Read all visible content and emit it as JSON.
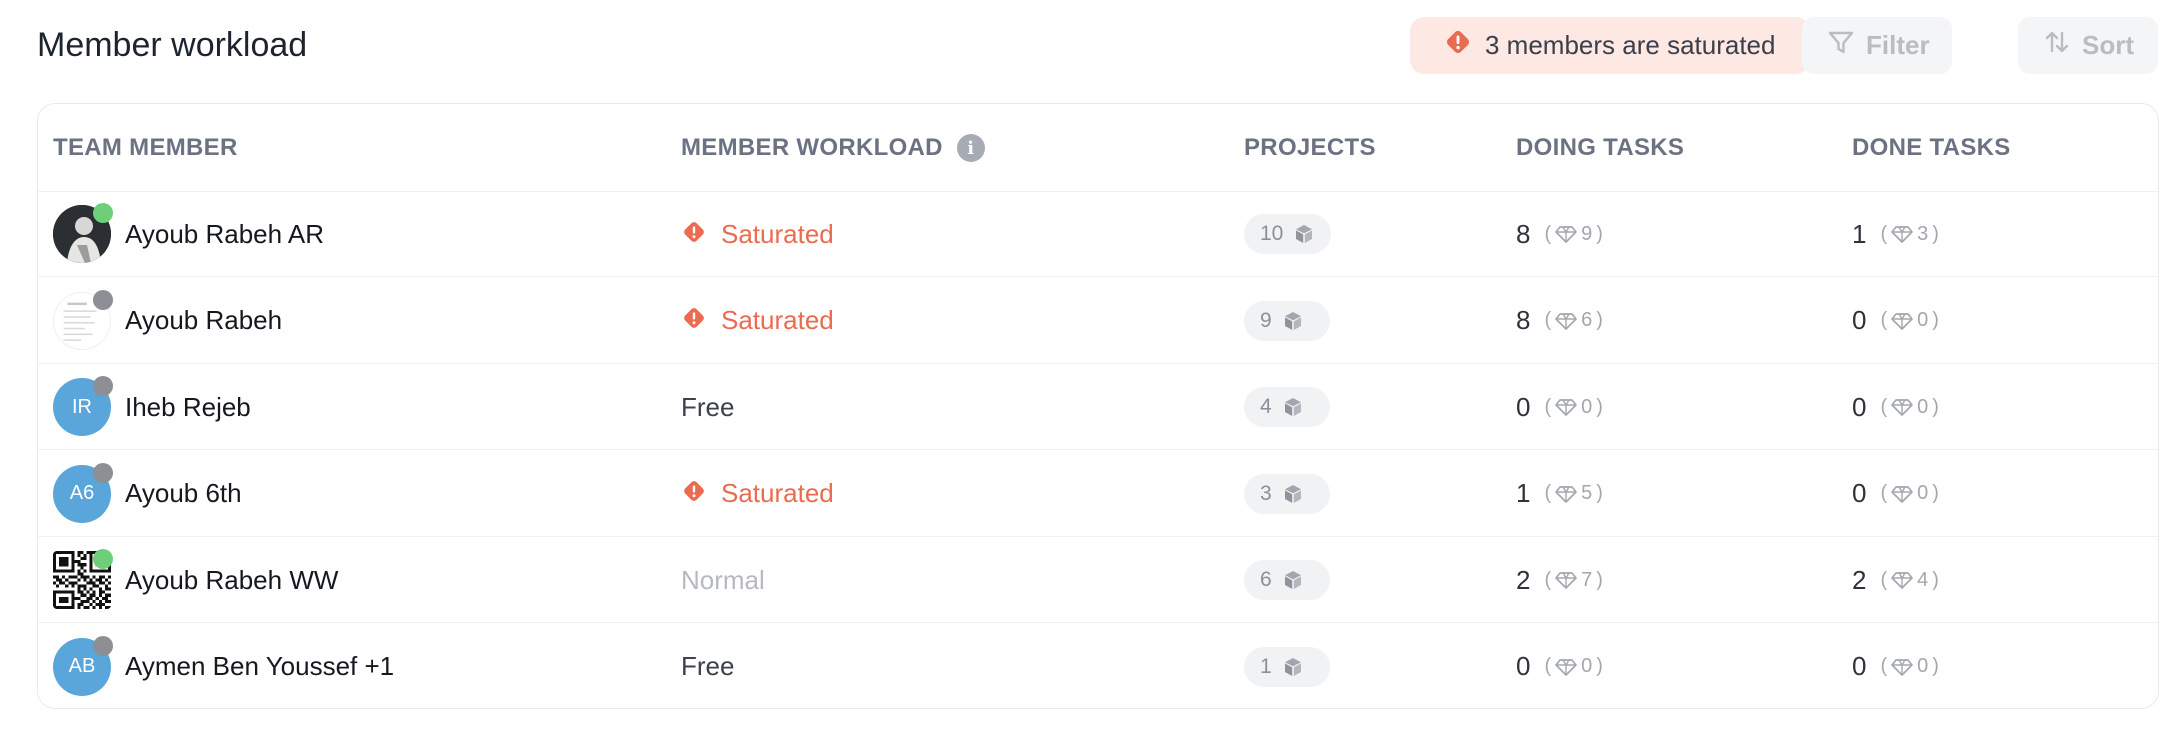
{
  "header": {
    "title": "Member workload",
    "alert_text": "3 members are saturated",
    "filter_label": "Filter",
    "sort_label": "Sort"
  },
  "colors": {
    "saturated": "#ea6b4f",
    "online": "#6fcf78",
    "offline": "#8d8f94",
    "initials_avatar": "#5aa5d9",
    "alert_bg": "#fde8e4"
  },
  "table": {
    "columns": {
      "member": "TEAM MEMBER",
      "workload": "MEMBER WORKLOAD",
      "projects": "PROJECTS",
      "doing": "DOING TASKS",
      "done": "DONE TASKS"
    },
    "info_glyph": "i",
    "rows": [
      {
        "name": "Ayoub Rabeh AR",
        "avatar": "photo",
        "status": "online",
        "workload": "Saturated",
        "projects": "10",
        "doing": "8",
        "doing_sub": "9",
        "done": "1",
        "done_sub": "3"
      },
      {
        "name": "Ayoub Rabeh",
        "avatar": "document",
        "status": "offline",
        "workload": "Saturated",
        "projects": "9",
        "doing": "8",
        "doing_sub": "6",
        "done": "0",
        "done_sub": "0"
      },
      {
        "name": "Iheb Rejeb",
        "avatar": "initials",
        "initials": "IR",
        "status": "offline",
        "workload": "Free",
        "projects": "4",
        "doing": "0",
        "doing_sub": "0",
        "done": "0",
        "done_sub": "0"
      },
      {
        "name": "Ayoub 6th",
        "avatar": "initials",
        "initials": "A6",
        "status": "offline",
        "workload": "Saturated",
        "projects": "3",
        "doing": "1",
        "doing_sub": "5",
        "done": "0",
        "done_sub": "0"
      },
      {
        "name": "Ayoub Rabeh WW",
        "avatar": "qr",
        "status": "online",
        "workload": "Normal",
        "projects": "6",
        "doing": "2",
        "doing_sub": "7",
        "done": "2",
        "done_sub": "4"
      },
      {
        "name": "Aymen Ben Youssef +1",
        "avatar": "initials",
        "initials": "AB",
        "status": "offline",
        "workload": "Free",
        "projects": "1",
        "doing": "0",
        "doing_sub": "0",
        "done": "0",
        "done_sub": "0"
      }
    ]
  }
}
